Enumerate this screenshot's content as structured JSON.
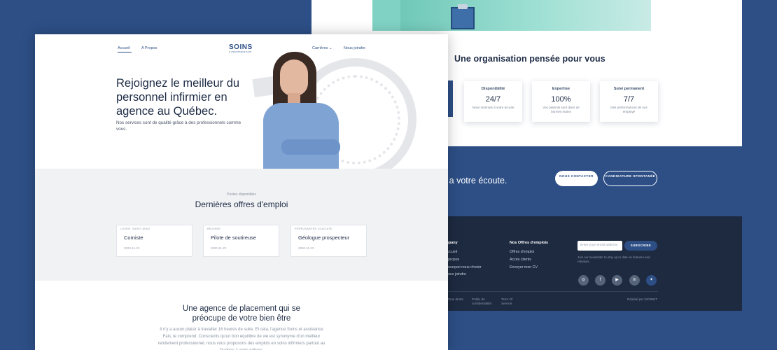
{
  "back": {
    "org_title": "Une organisation pensée pour vous",
    "features": [
      {
        "title": "Disponibilité",
        "value": "24/7",
        "desc": "Nous sommes à votre écoute"
      },
      {
        "title": "Expertise",
        "value": "100%",
        "desc": "Vos patients sont dans de bonnes mains"
      },
      {
        "title": "Suivi permanent",
        "value": "7/7",
        "desc": "Des performances de nos employé"
      }
    ],
    "banner_text": "es a votre écoute.",
    "contact_button": "NOUS CONTACTER",
    "apply_button": "CANDIDATURE SPONTANÉE",
    "footer": {
      "company_title": "mpany",
      "company_links": [
        "Accueil",
        "propos",
        "ourquoi nous choisir",
        "ous joindre"
      ],
      "offers_title": "Nos Offres d'emplois",
      "offers_links": [
        "Offres d'emploi",
        "Accès clients",
        "Envoyer mon CV"
      ],
      "email_placeholder": "Enter your email address",
      "subscribe_label": "SUBSCRIBE",
      "newsletter_text": "Join our newsletter to stay up to date on features and releases.",
      "social": [
        "instagram-icon",
        "facebook-icon",
        "youtube-icon",
        "linkedin-icon",
        "twitter-icon"
      ],
      "copyright": ". Tous droits",
      "privacy": "Politic de confidentialité",
      "terms": "Term Of Service",
      "credit": "Réalisé par DIGINET"
    }
  },
  "front": {
    "nav": {
      "home": "Accueil",
      "about": "A Propos",
      "careers": "Carrières",
      "join": "Nous joindre"
    },
    "logo": "SOINS",
    "logo_sub": "& ASSISTANCE FAIS",
    "hero_title": "Rejoignez le meilleur du personnel infirmier en agence au Québec.",
    "hero_subtitle": "Nos services sont de qualité grâce à des professionnels comme vous.",
    "jobs_kicker": "Postes disponibles",
    "jobs_title": "Dernières offres d'emploi",
    "jobs": [
      {
        "region": "LOISIR, SAINT-JEAN",
        "title": "Corniste",
        "date": "2020-11-23"
      },
      {
        "region": "REGINEK",
        "title": "Pilote de soutireuse",
        "date": "2020-11-23"
      },
      {
        "region": "PERFUSANTES GLACIATE",
        "title": "Géologue prospecteur",
        "date": "2020-11-23"
      }
    ],
    "agency_title_1": "Une agence de placement qui se",
    "agency_title_2": "préocupe de votre bien être",
    "agency_text": "Il n'y a aucun plaisir à travailler 16 heures de suite. Et cela, l'agence Soins et assistance Fais, le comprend. Conscients qu'un bon équilibre de vie est synonyme d'un meilleur rendement professionnel, nous vous proposons des emplois en soins infirmiers partout au Québec à votre rythme."
  },
  "colors": {
    "brand": "#2d4f86",
    "dark": "#1d2a40",
    "text": "#1d2b45"
  }
}
